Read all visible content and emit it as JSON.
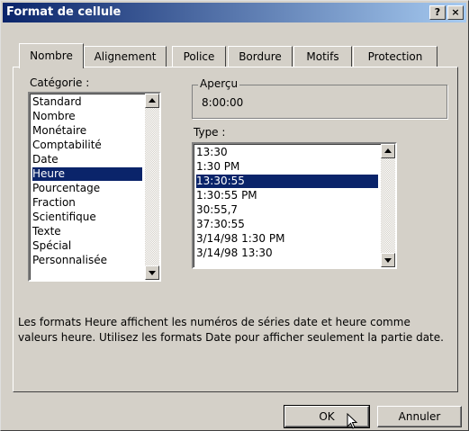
{
  "window": {
    "title": "Format de cellule",
    "help_label": "?",
    "close_label": "×"
  },
  "tabs": [
    {
      "label": "Nombre",
      "active": true
    },
    {
      "label": "Alignement"
    },
    {
      "label": "Police"
    },
    {
      "label": "Bordure"
    },
    {
      "label": "Motifs"
    },
    {
      "label": "Protection"
    }
  ],
  "category": {
    "label": "Catégorie :",
    "items": [
      "Standard",
      "Nombre",
      "Monétaire",
      "Comptabilité",
      "Date",
      "Heure",
      "Pourcentage",
      "Fraction",
      "Scientifique",
      "Texte",
      "Spécial",
      "Personnalisée"
    ],
    "selected": "Heure"
  },
  "preview": {
    "label": "Aperçu",
    "value": "8:00:00"
  },
  "type": {
    "label": "Type :",
    "items": [
      "13:30",
      "1:30 PM",
      "13:30:55",
      "1:30:55 PM",
      "30:55,7",
      "37:30:55",
      "3/14/98 1:30 PM",
      "3/14/98 13:30"
    ],
    "selected": "13:30:55"
  },
  "description": "Les formats Heure affichent les numéros de séries date et heure comme valeurs heure. Utilisez les formats Date pour afficher seulement la partie date.",
  "buttons": {
    "ok": "OK",
    "cancel": "Annuler"
  }
}
